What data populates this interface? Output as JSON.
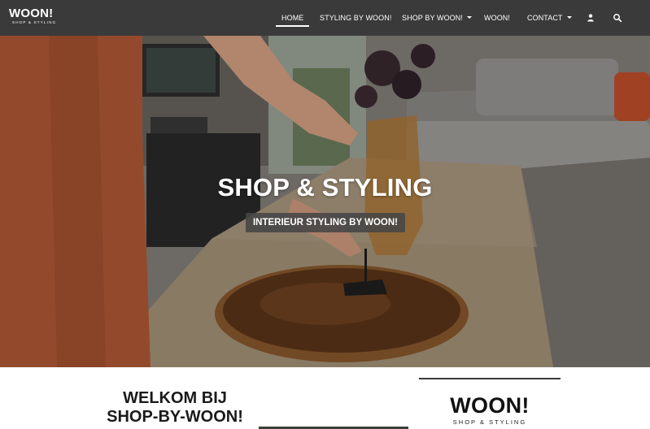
{
  "header": {
    "logo_main": "WOON!",
    "logo_sub": "SHOP & STYLING",
    "nav": [
      {
        "label": "HOME",
        "active": true,
        "has_caret": false
      },
      {
        "label": "STYLING BY WOON!",
        "active": false,
        "has_caret": false
      },
      {
        "label": "SHOP BY WOON!",
        "active": false,
        "has_caret": true
      },
      {
        "label": "WOON!",
        "active": false,
        "has_caret": false
      },
      {
        "label": "CONTACT",
        "active": false,
        "has_caret": true
      }
    ],
    "icons": [
      "user-icon",
      "search-icon"
    ],
    "background_color": "#3a3a3a"
  },
  "hero": {
    "title": "SHOP & STYLING",
    "button_label": "INTERIEUR STYLING BY WOON!"
  },
  "welcome": {
    "line1": "WELKOM BIJ",
    "line2": "SHOP-BY-WOON!"
  },
  "brand": {
    "main": "WOON!",
    "sub": "SHOP & STYLING"
  }
}
